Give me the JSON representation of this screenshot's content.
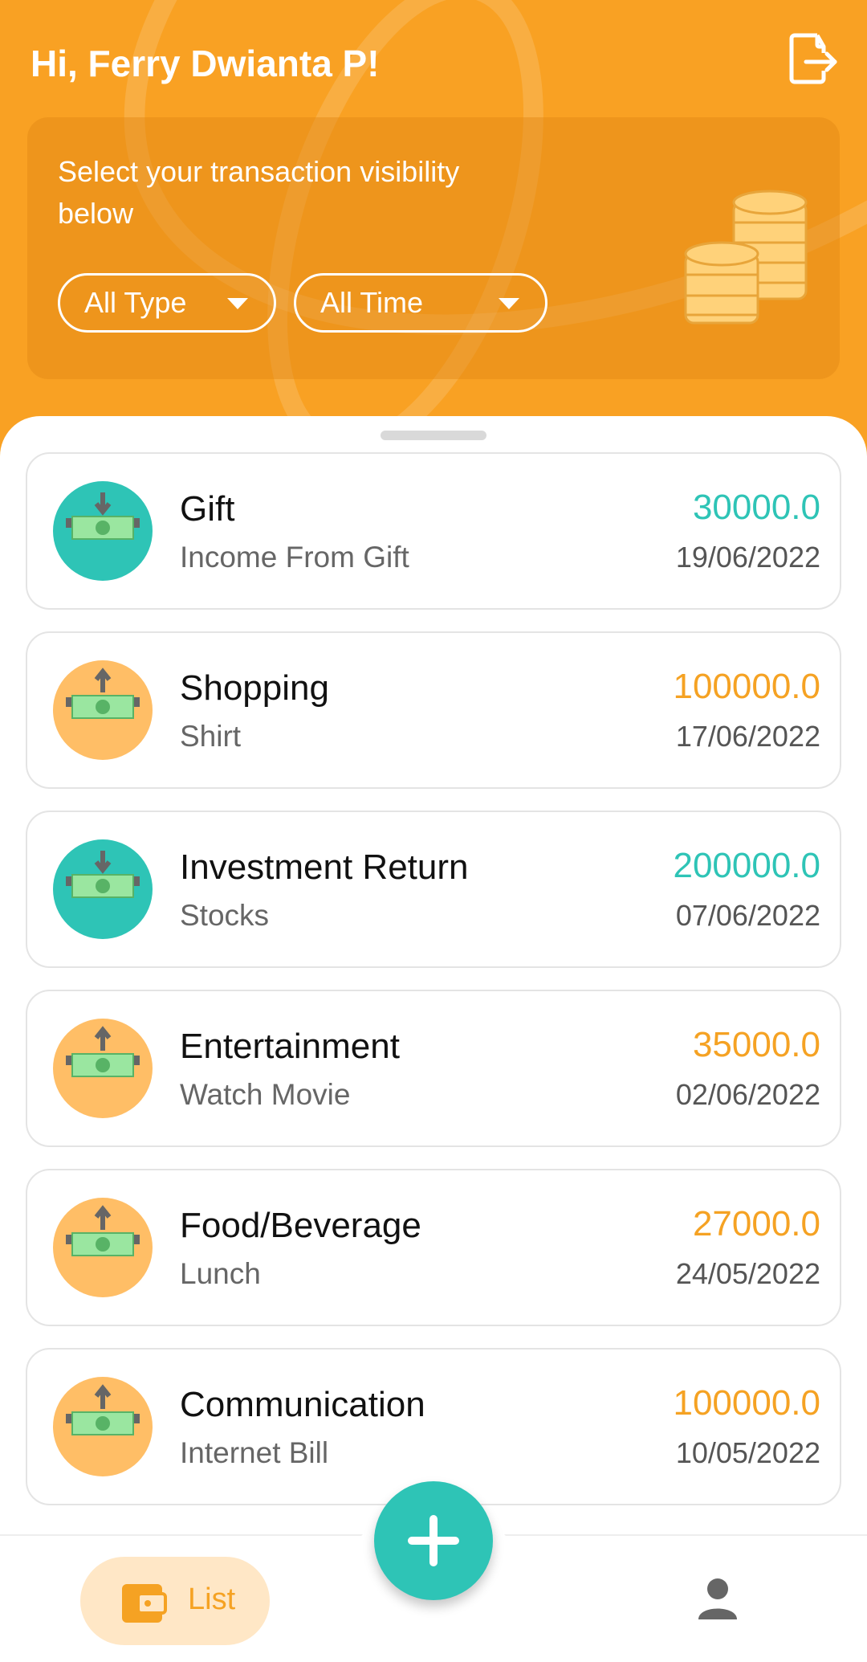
{
  "header": {
    "greeting": "Hi, Ferry Dwianta P!",
    "logout_icon": "logout-icon"
  },
  "filter": {
    "prompt": "Select your transaction visibility below",
    "type_selected": "All Type",
    "time_selected": "All Time",
    "illustration": "coins-icon"
  },
  "colors": {
    "accent": "#F9A123",
    "income": "#2EC4B6",
    "expense": "#F5A223",
    "expense_icon_bg": "#FFBE66"
  },
  "transactions": [
    {
      "type": "income",
      "title": "Gift",
      "subtitle": "Income From Gift",
      "amount": "30000.0",
      "date": "19/06/2022"
    },
    {
      "type": "expense",
      "title": "Shopping",
      "subtitle": "Shirt",
      "amount": "100000.0",
      "date": "17/06/2022"
    },
    {
      "type": "income",
      "title": "Investment Return",
      "subtitle": "Stocks",
      "amount": "200000.0",
      "date": "07/06/2022"
    },
    {
      "type": "expense",
      "title": "Entertainment",
      "subtitle": "Watch Movie",
      "amount": "35000.0",
      "date": "02/06/2022"
    },
    {
      "type": "expense",
      "title": "Food/Beverage",
      "subtitle": "Lunch",
      "amount": "27000.0",
      "date": "24/05/2022"
    },
    {
      "type": "expense",
      "title": "Communication",
      "subtitle": "Internet Bill",
      "amount": "100000.0",
      "date": "10/05/2022"
    }
  ],
  "bottom_nav": {
    "list_label": "List",
    "list_icon": "wallet-icon",
    "profile_icon": "profile-icon",
    "add_icon": "plus-icon"
  }
}
